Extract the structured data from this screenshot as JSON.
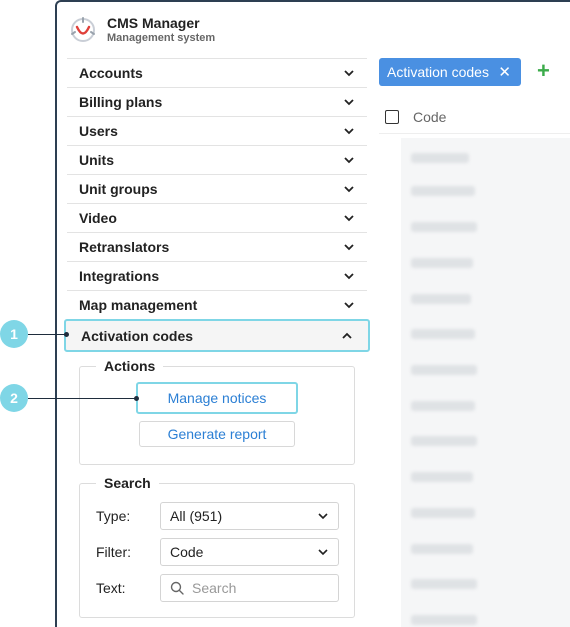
{
  "app": {
    "title": "CMS Manager",
    "subtitle": "Management system"
  },
  "menu": {
    "items": [
      {
        "label": "Accounts"
      },
      {
        "label": "Billing plans"
      },
      {
        "label": "Users"
      },
      {
        "label": "Units"
      },
      {
        "label": "Unit groups"
      },
      {
        "label": "Video"
      },
      {
        "label": "Retranslators"
      },
      {
        "label": "Integrations"
      },
      {
        "label": "Map management"
      },
      {
        "label": "Activation codes",
        "expanded": true
      }
    ]
  },
  "actions": {
    "legend": "Actions",
    "manage_notices": "Manage notices",
    "generate_report": "Generate report"
  },
  "search": {
    "legend": "Search",
    "type_label": "Type:",
    "type_value": "All (951)",
    "filter_label": "Filter:",
    "filter_value": "Code",
    "text_label": "Text:",
    "text_placeholder": "Search"
  },
  "main": {
    "tab_label": "Activation codes",
    "column_code": "Code"
  },
  "markers": {
    "m1": "1",
    "m2": "2"
  },
  "colors": {
    "accent": "#4a90e2",
    "highlight": "#7fd6e6",
    "add": "#3bab4a",
    "link": "#2b7fd4"
  }
}
